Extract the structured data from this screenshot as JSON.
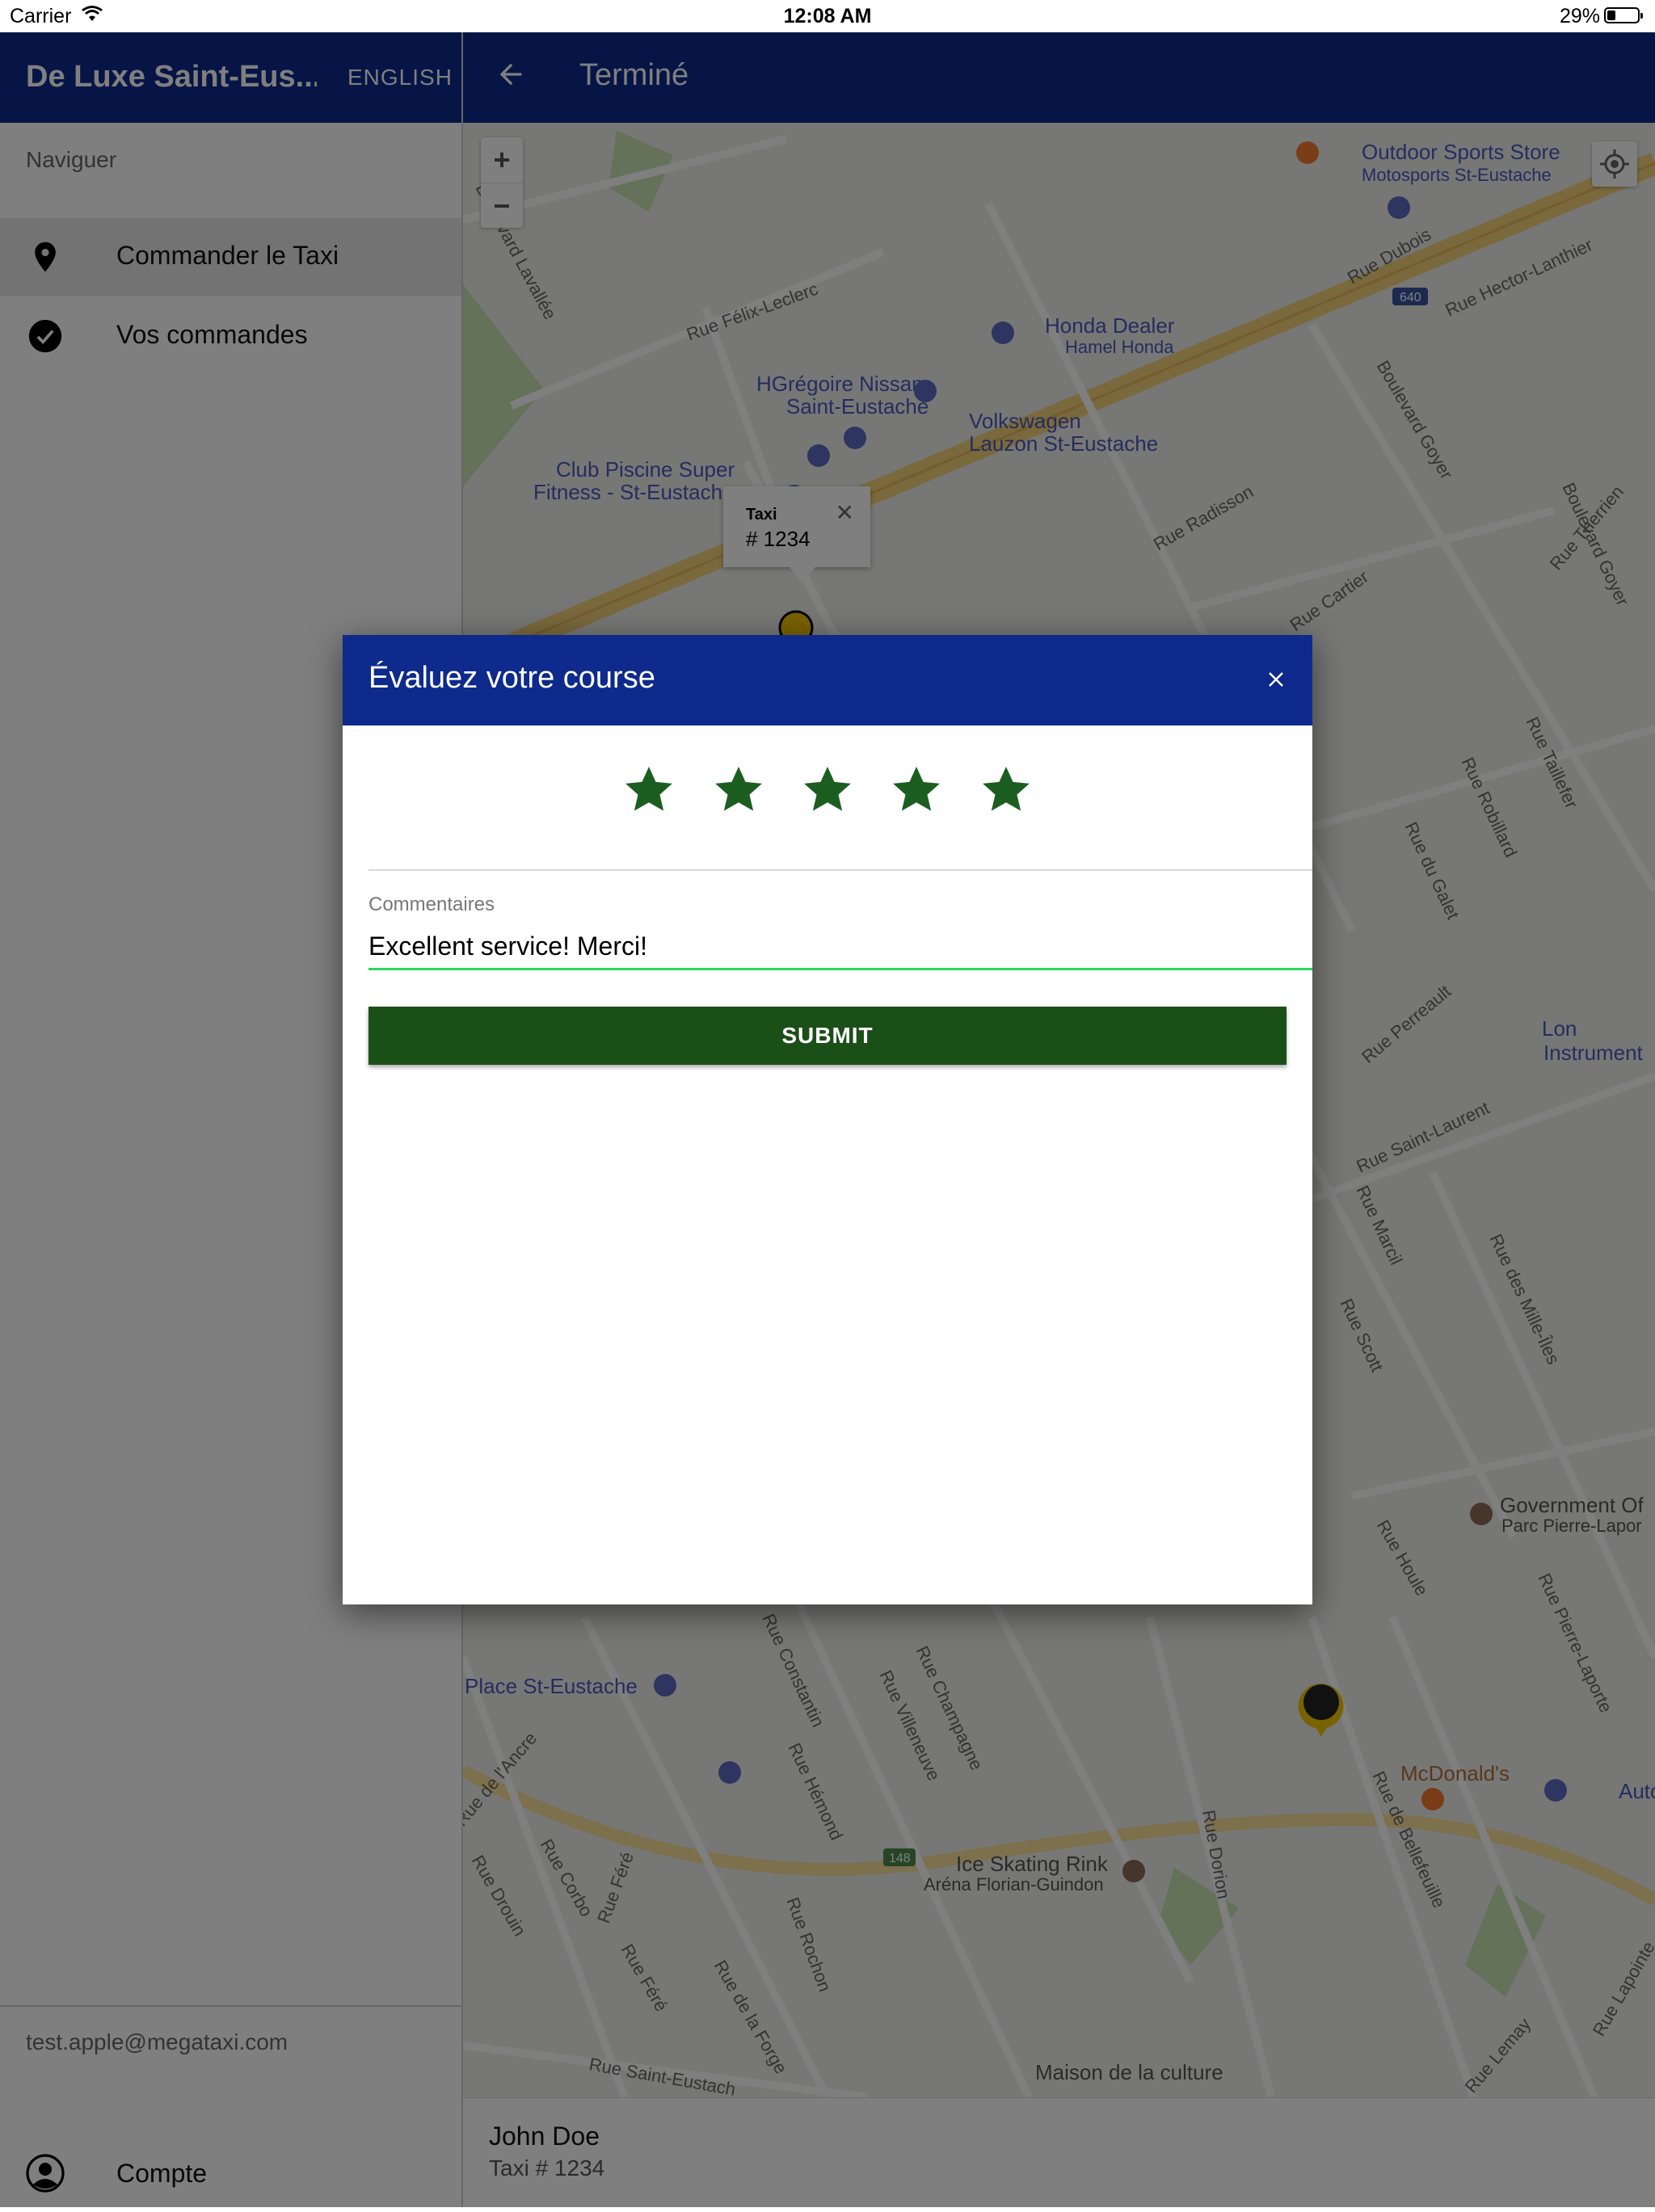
{
  "status_bar": {
    "carrier": "Carrier",
    "time": "12:08 AM",
    "battery": "29%"
  },
  "sidebar": {
    "title": "De Luxe Saint-Eus...",
    "language_button": "ENGLISH",
    "nav_label": "Naviguer",
    "items": [
      {
        "label": "Commander le Taxi",
        "icon": "map-pin-icon",
        "active": true
      },
      {
        "label": "Vos commandes",
        "icon": "check-circle-icon",
        "active": false
      }
    ],
    "email": "test.apple@megataxi.com",
    "account_label": "Compte"
  },
  "header": {
    "title": "Terminé"
  },
  "map": {
    "zoom_in": "+",
    "zoom_out": "−",
    "info_window": {
      "title": "Taxi",
      "number": "# 1234",
      "close": "✕"
    },
    "labels": [
      "Outdoor Sports Store",
      "Motosports St-Eustache",
      "Rue Dubois",
      "640",
      "Rue Hector-Lanthier",
      "Boulevard Lavallée",
      "Rue Félix-Leclerc",
      "Honda Dealer",
      "Hamel Honda",
      "HGrégoire Nissan",
      "Saint-Eustache",
      "Volkswagen",
      "Lauzon St-Eustache",
      "Club Piscine Super",
      "Fitness - St-Eustach",
      "Rue Radisson",
      "Boulevard Goyer",
      "Rue Cartier",
      "Rue Therrien",
      "Rue Taillefer",
      "Rue Robillard",
      "Rue du Galet",
      "Rue Perreault",
      "Rue Saint-Laurent",
      "Rue Marcil",
      "Rue Scott",
      "Rue des Mille-Îles",
      "Government Of",
      "Parc Pierre-Lapor",
      "Rue Houle",
      "Rue Pierre-Laporte",
      "Place St-Eustache",
      "Rue Constantin",
      "Rue Villeneuve",
      "Rue Champagne",
      "McDonald's",
      "Auto Ale",
      "Rue de Bellefeuille",
      "Rue Hémond",
      "Ice Skating Rink",
      "Aréna Florian-Guindon",
      "Rue Dorion",
      "148",
      "Rue de l'Ancre",
      "Rue Drouin",
      "Rue Corbo",
      "Rue Féré",
      "Rue Rochon",
      "Rue de la Forge",
      "Rue Saint-Eustach",
      "Maison de la culture",
      "Rue Lemay",
      "Rue Lapointe",
      "Lon",
      "Instrument"
    ]
  },
  "driver": {
    "name": "John Doe",
    "taxi": "Taxi # 1234"
  },
  "modal": {
    "title": "Évaluez votre course",
    "rating": 5,
    "max_rating": 5,
    "comments_label": "Commentaires",
    "comments_value": "Excellent service! Merci!",
    "submit_label": "SUBMIT"
  },
  "colors": {
    "header_bg": "#0d2a8c",
    "star": "#1b5e20",
    "submit_bg": "#1b4f18",
    "input_underline": "#2fd55f"
  }
}
